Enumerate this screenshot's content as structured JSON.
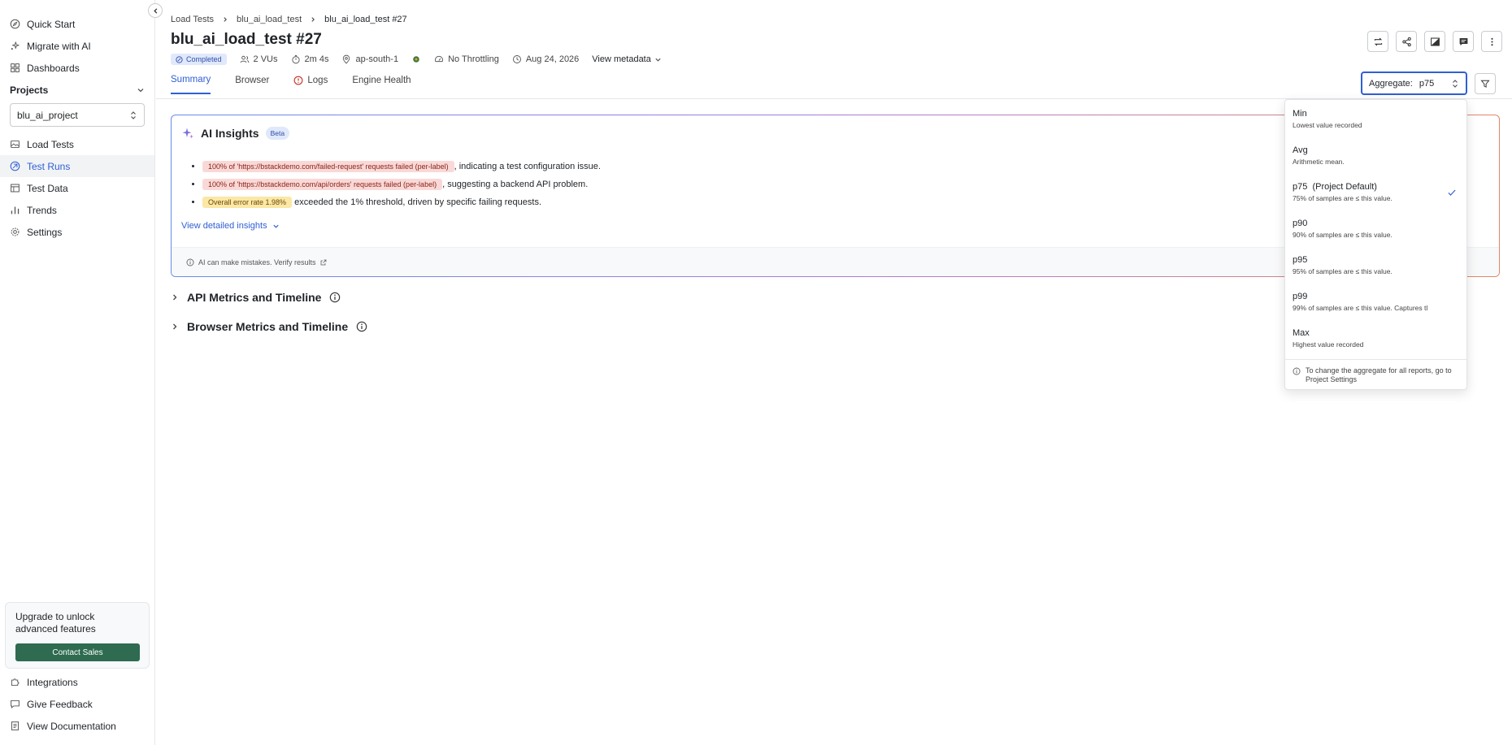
{
  "sidebar": {
    "nav_top": [
      {
        "label": "Quick Start",
        "icon": "compass-icon"
      },
      {
        "label": "Migrate with AI",
        "icon": "sparkle-icon"
      },
      {
        "label": "Dashboards",
        "icon": "grid-icon"
      }
    ],
    "projects_label": "Projects",
    "project_selected": "blu_ai_project",
    "nav_project": [
      {
        "label": "Load Tests",
        "icon": "image-icon"
      },
      {
        "label": "Test Runs",
        "icon": "run-icon",
        "active": true
      },
      {
        "label": "Test Data",
        "icon": "table-icon"
      },
      {
        "label": "Trends",
        "icon": "bar-chart-icon"
      },
      {
        "label": "Settings",
        "icon": "gear-icon"
      }
    ],
    "upgrade_text": "Upgrade to unlock advanced features",
    "contact_label": "Contact Sales",
    "nav_bottom": [
      {
        "label": "Integrations",
        "icon": "puzzle-icon"
      },
      {
        "label": "Give Feedback",
        "icon": "feedback-icon"
      },
      {
        "label": "View Documentation",
        "icon": "doc-icon"
      }
    ]
  },
  "header": {
    "breadcrumb": [
      "Load Tests",
      "blu_ai_load_test",
      "blu_ai_load_test #27"
    ],
    "title": "blu_ai_load_test #27",
    "status": "Completed",
    "vus": "2 VUs",
    "duration": "2m 4s",
    "region": "ap-south-1",
    "throttling": "No Throttling",
    "date": "Aug 24, 2026",
    "view_metadata": "View metadata"
  },
  "tabs": [
    "Summary",
    "Browser",
    "Logs",
    "Engine Health"
  ],
  "aggregate": {
    "label": "Aggregate:",
    "value": "p75"
  },
  "insights": {
    "title": "AI Insights",
    "beta": "Beta",
    "items": [
      {
        "pill": "100% of 'https://bstackdemo.com/failed-request' requests failed (per-label)",
        "text": ", indicating a test configuration issue."
      },
      {
        "pill": "100% of 'https://bstackdemo.com/api/orders' requests failed (per-label)",
        "text": ", suggesting a backend API problem."
      },
      {
        "pill": "Overall error rate 1.98%",
        "text": " exceeded the 1% threshold, driven by specific failing requests."
      }
    ],
    "view_detailed": "View detailed insights",
    "disclaimer": "AI can make mistakes. Verify results"
  },
  "sections": [
    "API Metrics and Timeline",
    "Browser Metrics and Timeline"
  ],
  "dropdown": {
    "options": [
      {
        "label": "Min",
        "desc": "Lowest value recorded"
      },
      {
        "label": "Avg",
        "desc": "Arithmetic mean."
      },
      {
        "label": "p75  (Project Default)",
        "desc": "75% of samples are ≤ this value.",
        "selected": true
      },
      {
        "label": "p90",
        "desc": "90% of samples are ≤ this value."
      },
      {
        "label": "p95",
        "desc": "95% of samples are ≤ this value."
      },
      {
        "label": "p99",
        "desc": "99% of samples are ≤ this value. Captures tl"
      },
      {
        "label": "Max",
        "desc": "Highest value recorded"
      }
    ],
    "footer": "To change the aggregate for all reports, go to Project Settings"
  },
  "colors": {
    "accent": "#2f5fd3",
    "contact": "#2e6b50",
    "error_pill": "#f9d9d7",
    "warning_pill": "#fbe7a6"
  }
}
